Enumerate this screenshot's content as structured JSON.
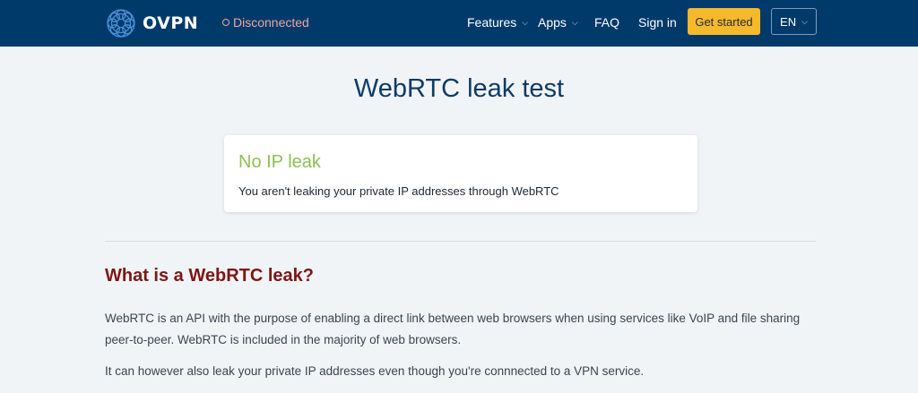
{
  "brand": {
    "name": "OVPN"
  },
  "status": {
    "label": "Disconnected",
    "color": "#f0a6a0"
  },
  "nav": {
    "features": "Features",
    "apps": "Apps",
    "faq": "FAQ",
    "signin": "Sign in",
    "get_started": "Get started",
    "language": "EN"
  },
  "page": {
    "title": "WebRTC leak test"
  },
  "result_card": {
    "title": "No IP leak",
    "message": "You aren't leaking your private IP addresses through WebRTC",
    "title_color": "#8cc152"
  },
  "section": {
    "heading": "What is a WebRTC leak?",
    "paragraph_1": "WebRTC is an API with the purpose of enabling a direct link between web browsers when using services like VoIP and file sharing peer-to-peer. WebRTC is included in the majority of web browsers.",
    "paragraph_2": "It can however also leak your private IP addresses even though you're connnected to a VPN service."
  },
  "colors": {
    "navbar": "#003a6b",
    "accent_button": "#f6b92b",
    "heading": "#7d1616",
    "title": "#0d3b66"
  },
  "icons": {
    "logo": "ovpn-logo-icon",
    "chevron": "chevron-down-icon",
    "status": "status-ring-icon"
  }
}
